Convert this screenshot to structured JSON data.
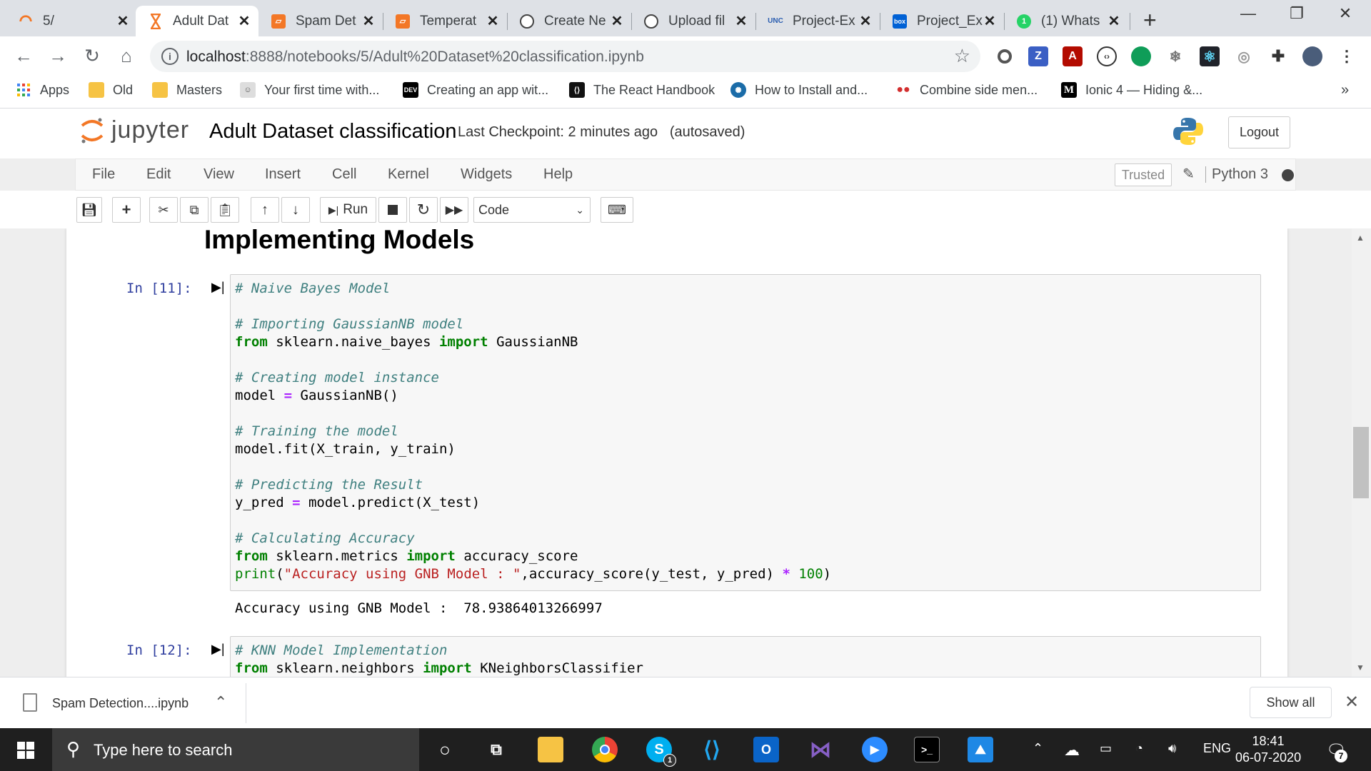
{
  "browser": {
    "tabs": [
      {
        "title": "5/",
        "icon": "jupyter-spinner-icon"
      },
      {
        "title": "Adult Dat",
        "icon": "hourglass-icon"
      },
      {
        "title": "Spam Det",
        "icon": "notebook-icon"
      },
      {
        "title": "Temperat",
        "icon": "notebook-icon"
      },
      {
        "title": "Create Ne",
        "icon": "github-icon"
      },
      {
        "title": "Upload fil",
        "icon": "github-icon"
      },
      {
        "title": "Project-Ex",
        "icon": "unc-icon"
      },
      {
        "title": "Project_Ex",
        "icon": "box-icon"
      },
      {
        "title": "(1) Whats",
        "icon": "whatsapp-icon"
      }
    ],
    "url_host": "localhost",
    "url_path": ":8888/notebooks/5/Adult%20Dataset%20classification.ipynb",
    "bookmarks": [
      {
        "label": "Apps"
      },
      {
        "label": "Old"
      },
      {
        "label": "Masters"
      },
      {
        "label": "Your first time with..."
      },
      {
        "label": "Creating an app wit..."
      },
      {
        "label": "The React Handbook"
      },
      {
        "label": "How to Install and..."
      },
      {
        "label": "Combine side men..."
      },
      {
        "label": "Ionic 4 — Hiding &..."
      }
    ],
    "bookmarks_more": "»"
  },
  "jupyter": {
    "logo_text": "jupyter",
    "notebook_title": "Adult Dataset classification",
    "checkpoint": "Last Checkpoint: 2 minutes ago",
    "save_status": "(autosaved)",
    "logout_label": "Logout",
    "menus": [
      "File",
      "Edit",
      "View",
      "Insert",
      "Cell",
      "Kernel",
      "Widgets",
      "Help"
    ],
    "trusted_label": "Trusted",
    "kernel_name": "Python 3",
    "run_label": "Run",
    "cell_type": "Code"
  },
  "notebook": {
    "heading": "Implementing Models",
    "cells": [
      {
        "prompt": "In [11]:",
        "output": "Accuracy using GNB Model :  78.93864013266997"
      },
      {
        "prompt": "In [12]:"
      }
    ]
  },
  "downloads": {
    "file_name": "Spam Detection....ipynb",
    "show_all_label": "Show all"
  },
  "taskbar": {
    "search_placeholder": "Type here to search",
    "language": "ENG",
    "time": "18:41",
    "date": "06-07-2020",
    "notification_count": "7",
    "skype_badge": "1"
  }
}
